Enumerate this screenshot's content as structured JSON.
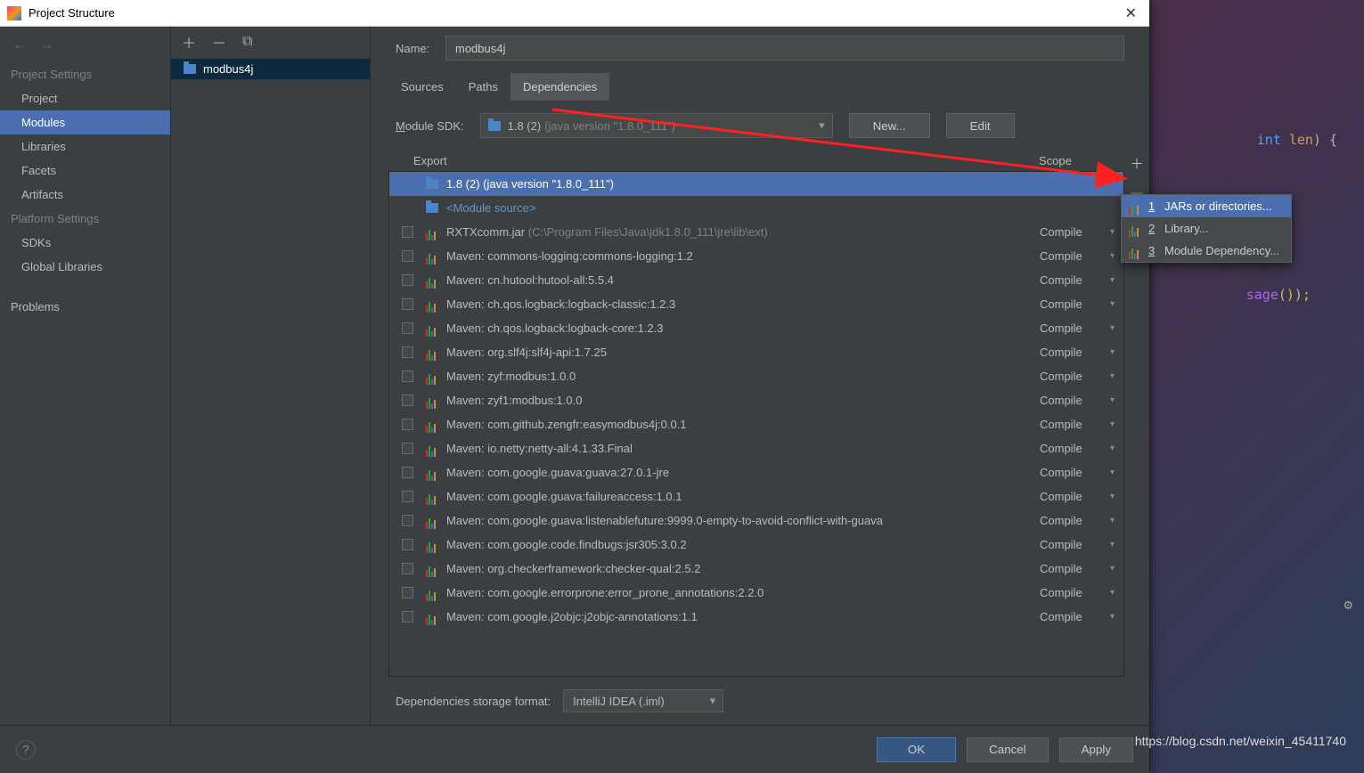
{
  "window_title": "Project Structure",
  "nav": {
    "cat1": "Project Settings",
    "items1": [
      "Project",
      "Modules",
      "Libraries",
      "Facets",
      "Artifacts"
    ],
    "cat2": "Platform Settings",
    "items2": [
      "SDKs",
      "Global Libraries"
    ],
    "problems": "Problems"
  },
  "module_tree": {
    "selected": "modbus4j"
  },
  "name_label": "Name:",
  "name_value": "modbus4j",
  "tabs": {
    "sources": "Sources",
    "paths": "Paths",
    "deps": "Dependencies"
  },
  "sdk": {
    "label_prefix": "M",
    "label_rest": "odule SDK:",
    "value": "1.8 (2)",
    "hint": "(java version \"1.8.0_111\")",
    "new": "New...",
    "edit": "Edit"
  },
  "table_header": {
    "export": "Export",
    "scope": "Scope"
  },
  "deps": [
    {
      "kind": "sdk",
      "label": "1.8 (2) (java version \"1.8.0_111\")",
      "selected": true,
      "checkbox": false,
      "scope": ""
    },
    {
      "kind": "modsrc",
      "label": "<Module source>",
      "checkbox": false,
      "scope": ""
    },
    {
      "kind": "jar",
      "label": "RXTXcomm.jar",
      "hint": "(C:\\Program Files\\Java\\jdk1.8.0_111\\jre\\lib\\ext)",
      "checkbox": true,
      "scope": "Compile"
    },
    {
      "kind": "lib",
      "label": "Maven: commons-logging:commons-logging:1.2",
      "checkbox": true,
      "scope": "Compile"
    },
    {
      "kind": "lib",
      "label": "Maven: cn.hutool:hutool-all:5.5.4",
      "checkbox": true,
      "scope": "Compile"
    },
    {
      "kind": "lib",
      "label": "Maven: ch.qos.logback:logback-classic:1.2.3",
      "checkbox": true,
      "scope": "Compile"
    },
    {
      "kind": "lib",
      "label": "Maven: ch.qos.logback:logback-core:1.2.3",
      "checkbox": true,
      "scope": "Compile"
    },
    {
      "kind": "lib",
      "label": "Maven: org.slf4j:slf4j-api:1.7.25",
      "checkbox": true,
      "scope": "Compile"
    },
    {
      "kind": "lib",
      "label": "Maven: zyf:modbus:1.0.0",
      "checkbox": true,
      "scope": "Compile"
    },
    {
      "kind": "lib",
      "label": "Maven: zyf1:modbus:1.0.0",
      "checkbox": true,
      "scope": "Compile"
    },
    {
      "kind": "lib",
      "label": "Maven: com.github.zengfr:easymodbus4j:0.0.1",
      "checkbox": true,
      "scope": "Compile"
    },
    {
      "kind": "lib",
      "label": "Maven: io.netty:netty-all:4.1.33.Final",
      "checkbox": true,
      "scope": "Compile"
    },
    {
      "kind": "lib",
      "label": "Maven: com.google.guava:guava:27.0.1-jre",
      "checkbox": true,
      "scope": "Compile"
    },
    {
      "kind": "lib",
      "label": "Maven: com.google.guava:failureaccess:1.0.1",
      "checkbox": true,
      "scope": "Compile"
    },
    {
      "kind": "lib",
      "label": "Maven: com.google.guava:listenablefuture:9999.0-empty-to-avoid-conflict-with-guava",
      "checkbox": true,
      "scope": "Compile"
    },
    {
      "kind": "lib",
      "label": "Maven: com.google.code.findbugs:jsr305:3.0.2",
      "checkbox": true,
      "scope": "Compile"
    },
    {
      "kind": "lib",
      "label": "Maven: org.checkerframework:checker-qual:2.5.2",
      "checkbox": true,
      "scope": "Compile"
    },
    {
      "kind": "lib",
      "label": "Maven: com.google.errorprone:error_prone_annotations:2.2.0",
      "checkbox": true,
      "scope": "Compile"
    },
    {
      "kind": "lib",
      "label": "Maven: com.google.j2objc:j2objc-annotations:1.1",
      "checkbox": true,
      "scope": "Compile"
    }
  ],
  "storage_label": "Dependencies storage format:",
  "storage_value": "IntelliJ IDEA (.iml)",
  "footer": {
    "ok": "OK",
    "cancel": "Cancel",
    "apply": "Apply"
  },
  "popup": {
    "items": [
      {
        "num": "1",
        "label": "JARs or directories...",
        "sel": true
      },
      {
        "num": "2",
        "label": "Library...",
        "sel": false
      },
      {
        "num": "3",
        "label": "Module Dependency...",
        "sel": false
      }
    ]
  },
  "bg_code": {
    "line1_kw": "int",
    "line1_var": "len",
    "line1_tail": ") {",
    "line2": "sage",
    "line2_paren": "());"
  },
  "watermark": "https://blog.csdn.net/weixin_45411740"
}
